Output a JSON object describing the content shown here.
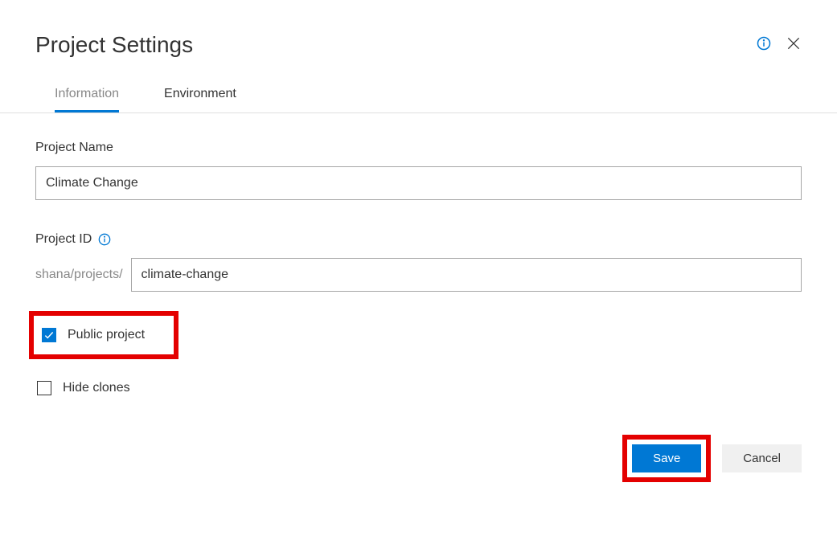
{
  "header": {
    "title": "Project Settings"
  },
  "tabs": {
    "information": "Information",
    "environment": "Environment",
    "active": "information"
  },
  "form": {
    "project_name_label": "Project Name",
    "project_name_value": "Climate Change",
    "project_id_label": "Project ID",
    "project_id_prefix": "shana/projects/",
    "project_id_value": "climate-change",
    "public_project_label": "Public project",
    "public_project_checked": true,
    "hide_clones_label": "Hide clones",
    "hide_clones_checked": false
  },
  "actions": {
    "save": "Save",
    "cancel": "Cancel"
  },
  "highlights": {
    "public_project": true,
    "save_button": true,
    "color": "#e40000"
  }
}
